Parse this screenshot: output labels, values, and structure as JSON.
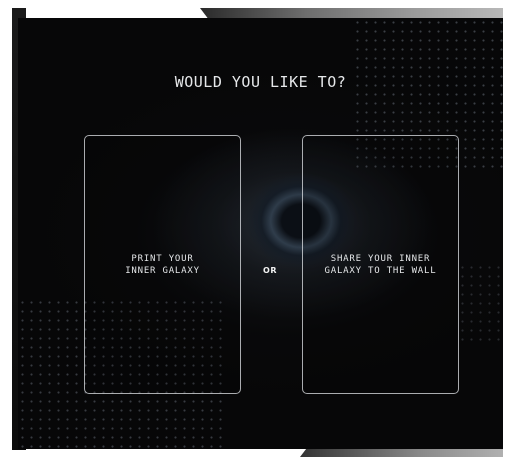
{
  "screen": {
    "title": "WOULD YOU LIKE TO?",
    "options": [
      {
        "label": "PRINT YOUR\nINNER GALAXY"
      },
      {
        "label": "SHARE YOUR INNER\nGALAXY TO THE WALL"
      }
    ],
    "separator": "OR"
  },
  "colors": {
    "background": "#070708",
    "text": "#e6e8ea",
    "card_border": "#e1e4e8"
  }
}
